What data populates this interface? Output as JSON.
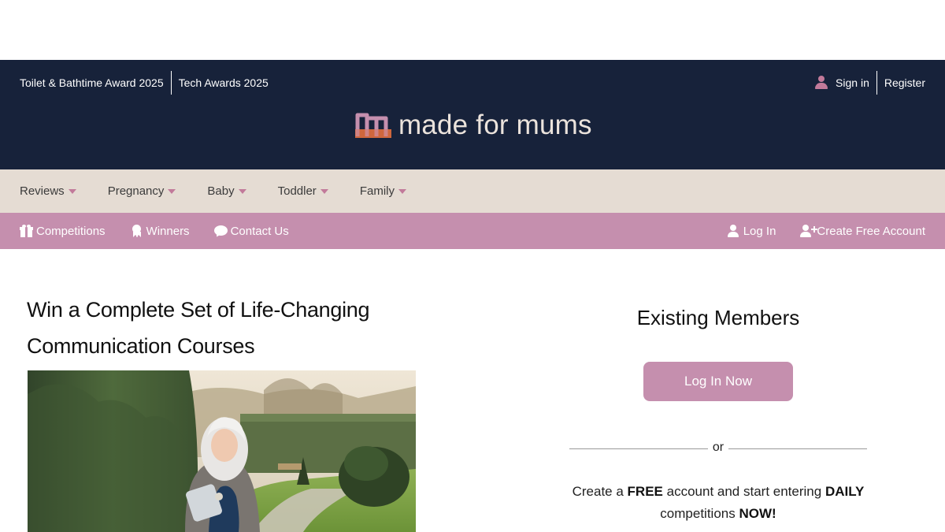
{
  "header": {
    "util_links": [
      "Toilet & Bathtime Award 2025",
      "Tech Awards 2025"
    ],
    "sign_in": "Sign in",
    "register": "Register",
    "logo_text": "made for mums"
  },
  "main_nav": {
    "items": [
      "Reviews",
      "Pregnancy",
      "Baby",
      "Toddler",
      "Family"
    ]
  },
  "sub_nav": {
    "competitions": "Competitions",
    "winners": "Winners",
    "contact": "Contact Us",
    "log_in": "Log In",
    "create_account": "Create Free Account"
  },
  "article": {
    "title": "Win a Complete Set of Life-Changing Communication Courses"
  },
  "members": {
    "heading": "Existing Members",
    "login_button": "Log In Now",
    "or": "or",
    "cta_1": "Create a",
    "cta_free": "FREE",
    "cta_2": "account and start entering",
    "cta_daily": "DAILY",
    "cta_3": "competitions",
    "cta_now": "NOW!"
  },
  "colors": {
    "header_bg": "#17223a",
    "nav_bg": "#e5dcd3",
    "accent_pink": "#c58fae",
    "caret_pink": "#c27a9a"
  }
}
